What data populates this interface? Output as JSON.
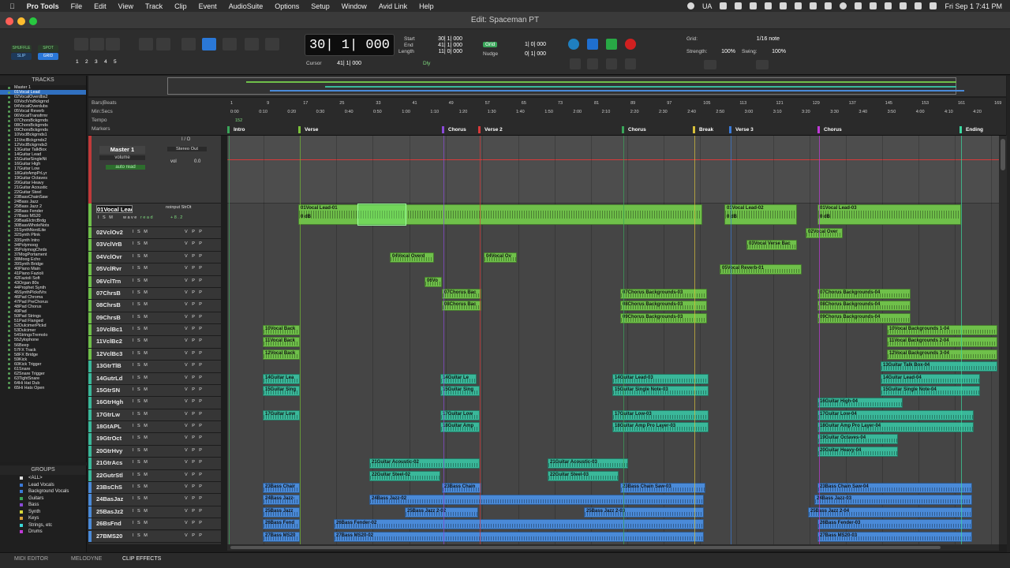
{
  "menubar": {
    "items": [
      "Pro Tools",
      "File",
      "Edit",
      "View",
      "Track",
      "Clip",
      "Event",
      "AudioSuite",
      "Options",
      "Setup",
      "Window",
      "Avid Link",
      "Help"
    ],
    "lang": "UA",
    "clock": "Fri Sep 1  7:41 PM"
  },
  "window": {
    "title": "Edit: Spaceman PT"
  },
  "toolbar": {
    "modes": [
      "SHUFFLE",
      "SPOT",
      "SLIP",
      "GRID"
    ],
    "zoom_presets": [
      "1",
      "2",
      "3",
      "4",
      "5"
    ],
    "main_counter": "30| 1| 000",
    "start_label": "Start",
    "end_label": "End",
    "length_label": "Length",
    "start_val": "30| 1| 000",
    "end_val": "41| 1| 000",
    "length_val": "11| 0| 000",
    "cursor_label": "Cursor",
    "cursor_val": "41| 1| 000",
    "dly": "Dly",
    "grid_label": "Grid",
    "grid_val": "1| 0| 000",
    "nudge_label": "Nudge",
    "nudge_val": "0| 1| 000",
    "grid2_label": "Grid:",
    "grid2_val": "1/16 note",
    "strength_label": "Strength:",
    "strength_val": "100%",
    "swing_label": "Swing:",
    "swing_val": "100%"
  },
  "tracks_panel": {
    "title": "TRACKS",
    "items": [
      "Master 1",
      "01Vocal Lead",
      "02VocalOverdbs2",
      "03VoclVrsBckgrnd",
      "04VocalOverdubs",
      "05Vocal Reverb",
      "06VocalTransfrmr",
      "07ChorsBckgrnds",
      "08ChorsBckgrnds",
      "09ChorsBckgrnds",
      "10VoclBckgrnds1",
      "11VoclBckgrnds2",
      "12VoclBckgrnds3",
      "13Guitar TalkBox",
      "14Guitar Lead",
      "15GuitarSingleNt",
      "16Guitar High",
      "17Guitar Low",
      "18GuitrAmpPrLyr",
      "19Guitar Octaves",
      "20Guitar Heavy",
      "21Guitar Acoustic",
      "22Guitar Steel",
      "23BassChainSaw",
      "24Bass Jazz",
      "25Bass Jazz 2",
      "26Bass Fender",
      "27Bass MS20",
      "29BasElctrcBrdg",
      "30BassWholeNots",
      "31SynthNordLite",
      "32Synth Plink",
      "33Synth Intro",
      "34Polymoog",
      "35PolymogChrds",
      "37MogPortament",
      "38Moog Echo",
      "39Synth Bridge",
      "40Piano Main",
      "41Piano Fazioli",
      "42Fazioli Soft",
      "43Organ 80s",
      "44Prophet Synth",
      "45SynthPlckdVrs",
      "46Pad Chroma",
      "47Pad PreChorus",
      "48Pad Chorus",
      "49Pad",
      "50Pad Strings",
      "51Pad Flanged",
      "52DulcimerPlckd",
      "53Dulcimer",
      "54StringsTremolo",
      "55Zylophone",
      "56Beep",
      "57FX Track",
      "58FX Bridge",
      "59Kick",
      "60Kick Trigger",
      "61Snare",
      "62Snare Trigger",
      "63TightSnare",
      "64Hi Hat Dub",
      "65Hi Hats Open"
    ]
  },
  "groups_panel": {
    "title": "GROUPS",
    "items": [
      "<ALL>",
      "Lead Vocals",
      "Background Vocals",
      "Guitars",
      "Bass",
      "Synth",
      "Keys",
      "Strings, etc",
      "Drums"
    ],
    "colors": [
      "#dddddd",
      "#3a7ad8",
      "#3a7ad8",
      "#3aa55a",
      "#8a4ad8",
      "#d8d83a",
      "#d8a03a",
      "#3ad8d8",
      "#c03ad8"
    ]
  },
  "bottom_tabs": [
    "MIDI EDITOR",
    "MELODYNE",
    "CLIP EFFECTS"
  ],
  "rulers": {
    "labels": [
      "Bars|Beats",
      "Min:Secs",
      "Tempo",
      "Markers"
    ],
    "tempo_val": "152",
    "bars": [
      "1",
      "9",
      "17",
      "25",
      "33",
      "41",
      "49",
      "57",
      "65",
      "73",
      "81",
      "89",
      "97",
      "105",
      "113",
      "121",
      "129",
      "137",
      "145",
      "153",
      "161",
      "169"
    ],
    "secs": [
      "0:00",
      "0:10",
      "0:20",
      "0:30",
      "0:40",
      "0:50",
      "1:00",
      "1:10",
      "1:20",
      "1:30",
      "1:40",
      "1:50",
      "2:00",
      "2:10",
      "2:20",
      "2:30",
      "2:40",
      "2:50",
      "3:00",
      "3:10",
      "3:20",
      "3:30",
      "3:40",
      "3:50",
      "4:00",
      "4:10",
      "4:20"
    ],
    "markers": [
      {
        "name": "Intro",
        "color": "#3aa55a"
      },
      {
        "name": "Verse",
        "color": "#7ac03a"
      },
      {
        "name": "Chorus",
        "color": "#8a4ad8"
      },
      {
        "name": "Verse 2",
        "color": "#d83a3a"
      },
      {
        "name": "Chorus",
        "color": "#3aa55a"
      },
      {
        "name": "Break",
        "color": "#d8c03a"
      },
      {
        "name": "Verse 3",
        "color": "#3a7ad8"
      },
      {
        "name": "Chorus",
        "color": "#c03ad8"
      },
      {
        "name": "Ending",
        "color": "#3ad8a0"
      }
    ]
  },
  "master": {
    "name": "Master 1",
    "plugin": "volume",
    "mode": "auto read",
    "out": "Stereo Out",
    "vol_label": "vol",
    "vol_val": "0.0",
    "io": "I / O"
  },
  "track_rows": [
    {
      "name": "01Vocal Lead",
      "io": "noinput StrOt",
      "vol": "+8.2"
    },
    {
      "name": "02VclOv2"
    },
    {
      "name": "03VclVrB"
    },
    {
      "name": "04VclOvr"
    },
    {
      "name": "05VclRvr"
    },
    {
      "name": "06VclTrn"
    },
    {
      "name": "07ChrsB"
    },
    {
      "name": "08ChrsB"
    },
    {
      "name": "09ChrsB"
    },
    {
      "name": "10VclBc1"
    },
    {
      "name": "11VclBc2"
    },
    {
      "name": "12VclBc3"
    },
    {
      "name": "13GtrTlB"
    },
    {
      "name": "14GutrLd"
    },
    {
      "name": "15GtrSN"
    },
    {
      "name": "16GtrHgh"
    },
    {
      "name": "17GtrLw"
    },
    {
      "name": "18GtAPL"
    },
    {
      "name": "19GtrOct"
    },
    {
      "name": "20GtrHvy"
    },
    {
      "name": "21GtrAcs"
    },
    {
      "name": "22GutrStl"
    },
    {
      "name": "23BsChS"
    },
    {
      "name": "24BasJaz"
    },
    {
      "name": "25BasJz2"
    },
    {
      "name": "26BsFnd"
    },
    {
      "name": "27BMS20"
    }
  ],
  "track_labels": {
    "ism": "I S M",
    "io": "V P P",
    "wave": "wave",
    "read": "read",
    "ismlead": "I S M",
    "vmode": "V P P"
  },
  "clips": [
    {
      "row": 0,
      "name": "01Vocal Lead-01",
      "vol": "0 dB"
    },
    {
      "row": 0,
      "name": "01Vocal Lead-02",
      "vol": "0 dB"
    },
    {
      "row": 0,
      "name": "01Vocal Lead-03",
      "vol": "0 dB"
    },
    {
      "row": 1,
      "name": "02Vocal Over"
    },
    {
      "row": 2,
      "name": "03Vocal Verse Bac"
    },
    {
      "row": 3,
      "name": "04Vocal Overd"
    },
    {
      "row": 3,
      "name": "04Vocal Ov"
    },
    {
      "row": 4,
      "name": "05Vocal Reverb-01"
    },
    {
      "row": 5,
      "name": "06Vo"
    },
    {
      "row": 6,
      "name": "07Chorus Bac"
    },
    {
      "row": 6,
      "name": "07Chorus Backgrounds-03"
    },
    {
      "row": 6,
      "name": "07Chorus Backgrounds-04"
    },
    {
      "row": 7,
      "name": "08Chorus Bac"
    },
    {
      "row": 7,
      "name": "08Chorus Backgrounds-03"
    },
    {
      "row": 7,
      "name": "08Chorus Backgrounds-04"
    },
    {
      "row": 8,
      "name": "09Chorus Backgrounds-03"
    },
    {
      "row": 8,
      "name": "09Chorus Backgrounds-04"
    },
    {
      "row": 9,
      "name": "10Vocal Back"
    },
    {
      "row": 9,
      "name": "10Vocal Backgrounds 1-04"
    },
    {
      "row": 10,
      "name": "11Vocal Back"
    },
    {
      "row": 10,
      "name": "11Vocal Backgrounds 2-04"
    },
    {
      "row": 11,
      "name": "12Vocal Back"
    },
    {
      "row": 11,
      "name": "12Vocal Backgrounds 3-04"
    },
    {
      "row": 12,
      "name": "13Guitar Talk Box-04"
    },
    {
      "row": 13,
      "name": "14Guitar Lea"
    },
    {
      "row": 13,
      "name": "14Guitar Le"
    },
    {
      "row": 13,
      "name": "14Guitar Lead-03"
    },
    {
      "row": 13,
      "name": "14Guitar Lead-04"
    },
    {
      "row": 14,
      "name": "15Guitar Sing"
    },
    {
      "row": 14,
      "name": "15Guitar Sing"
    },
    {
      "row": 14,
      "name": "15Guitar Single Note-03"
    },
    {
      "row": 14,
      "name": "15Guitar Single Note-04"
    },
    {
      "row": 15,
      "name": "16Guitar High-04"
    },
    {
      "row": 16,
      "name": "17Guitar Low"
    },
    {
      "row": 16,
      "name": "17Guitar Low"
    },
    {
      "row": 16,
      "name": "17Guitar Low-03"
    },
    {
      "row": 16,
      "name": "17Guitar Low-04"
    },
    {
      "row": 17,
      "name": "18Guitar Amp"
    },
    {
      "row": 17,
      "name": "18Guitar Amp Pro Layer-03"
    },
    {
      "row": 17,
      "name": "18Guitar Amp Pro Layer-04"
    },
    {
      "row": 18,
      "name": "19Guitar Octaves-04"
    },
    {
      "row": 19,
      "name": "20Guitar Heavy-04"
    },
    {
      "row": 20,
      "name": "21Guitar Acoustic-02"
    },
    {
      "row": 20,
      "name": "21Guitar Acoustic-03"
    },
    {
      "row": 21,
      "name": "22Guitar Steel-02"
    },
    {
      "row": 21,
      "name": "22Guitar Steel-03"
    },
    {
      "row": 22,
      "name": "23Bass Chair"
    },
    {
      "row": 22,
      "name": "23Bass Chain"
    },
    {
      "row": 22,
      "name": "23Bass Chain Saw-03"
    },
    {
      "row": 22,
      "name": "23Bass Chain Saw-04"
    },
    {
      "row": 23,
      "name": "24Bass Jazz-"
    },
    {
      "row": 23,
      "name": "24Bass Jazz-02"
    },
    {
      "row": 23,
      "name": "24Bass Jazz-03"
    },
    {
      "row": 24,
      "name": "25Bass Jazz"
    },
    {
      "row": 24,
      "name": "25Bass Jazz 2-02"
    },
    {
      "row": 24,
      "name": "25Bass Jazz 2-03"
    },
    {
      "row": 24,
      "name": "25Bass Jazz 2-04"
    },
    {
      "row": 25,
      "name": "26Bass Fend"
    },
    {
      "row": 25,
      "name": "26Bass Fender-02"
    },
    {
      "row": 25,
      "name": "26Bass Fender-03"
    },
    {
      "row": 26,
      "name": "27Bass MS20"
    },
    {
      "row": 26,
      "name": "27Bass MS20-02"
    },
    {
      "row": 26,
      "name": "27Bass MS20-03"
    }
  ],
  "colors": {
    "vocal": "#6fc04a",
    "vocal_sel": "#4fa83a",
    "guitar": "#3ab89a",
    "bass": "#4a8ad8",
    "accent": "#2a78d8"
  }
}
